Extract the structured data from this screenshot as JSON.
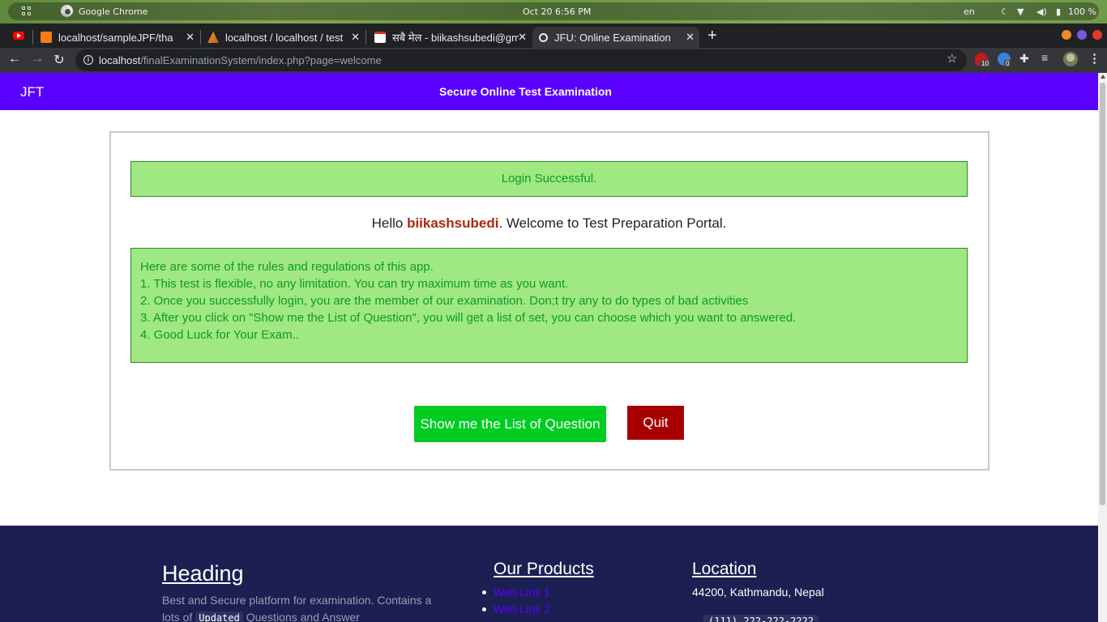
{
  "os": {
    "app_name": "Google Chrome",
    "datetime": "Oct 20   6:56 PM",
    "lang": "en",
    "battery": "100 %"
  },
  "browser": {
    "tabs": [
      {
        "title": "localhost/sampleJPF/tha",
        "favicon": "xampp-icon"
      },
      {
        "title": "localhost / localhost / test",
        "favicon": "phpmyadmin-icon"
      },
      {
        "title": "सबै मेल - biikashsubedi@gm",
        "favicon": "gmail-icon"
      },
      {
        "title": "JFU: Online Examination",
        "favicon": "loading-icon",
        "active": true
      }
    ],
    "url_host": "localhost",
    "url_path": "/finalExaminationSystem/index.php?page=welcome",
    "extension_badges": [
      "10",
      "0"
    ]
  },
  "header": {
    "brand": "JFT",
    "tagline": "Secure Online Test Examination",
    "bg_color": "#5a00ff"
  },
  "main": {
    "alert": "Login Successful.",
    "hello_prefix": "Hello ",
    "username": "biikashsubedi",
    "hello_suffix": ". Welcome to Test Preparation Portal.",
    "rules": [
      "Here are some of the rules and regulations of this app.",
      "1. This test is flexible, no any limitation. You can try maximum time as you want.",
      "2. Once you successfully login, you are the member of our examination. Don;t try any to do types of bad activities",
      "3. After you click on \"Show me the List of Question\", you will get a list of set, you can choose which you want to answered.",
      "4. Good Luck for Your Exam.."
    ],
    "btn_list": "Show me the List of Question",
    "btn_quit": "Quit"
  },
  "footer": {
    "heading": "Heading",
    "text_before": "Best and Secure platform for examination. Contains a lots of ",
    "text_code": "Updated",
    "text_after": " Questions and Answer",
    "products_title": "Our Products",
    "links": [
      "Web Link 1",
      "Web Link 2"
    ],
    "location_title": "Location",
    "address": "44200, Kathmandu, Nepal",
    "phone": "(111) 222-222-2222"
  }
}
